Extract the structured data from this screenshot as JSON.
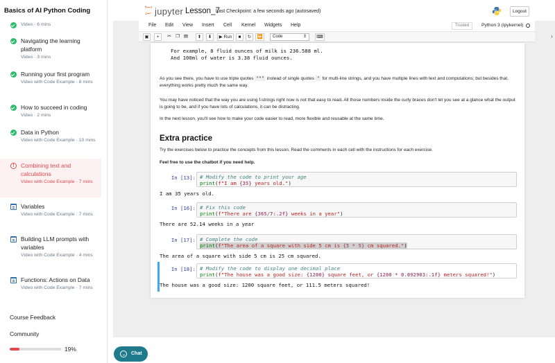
{
  "sidebar": {
    "course_title": "Basics of AI Python Coding",
    "lessons": [
      {
        "name": "",
        "meta": "Video · 6 mins",
        "status": "check"
      },
      {
        "name": "Navigating the learning platform",
        "meta": "Video · 3 mins",
        "status": "check"
      },
      {
        "name": "Running your first program",
        "meta": "Video with Code Example · 8 mins",
        "status": "check"
      },
      {
        "name": "How to succeed in coding",
        "meta": "Video · 2 mins",
        "status": "check"
      },
      {
        "name": "Data in Python",
        "meta": "Video with Code Example · 10 mins",
        "status": "check"
      },
      {
        "name": "Combining text and calculations",
        "meta": "Video with Code Example · 7 mins",
        "status": "warn"
      },
      {
        "name": "Variables",
        "meta": "Video with Code Example · 7 mins",
        "status": "code"
      },
      {
        "name": "Building LLM prompts with variables",
        "meta": "Video with Code Example · 4 mins",
        "status": "code"
      },
      {
        "name": "Functions: Actions on Data",
        "meta": "Video with Code Example · 7 mins",
        "status": "code"
      }
    ],
    "course_feedback": "Course Feedback",
    "community": "Community",
    "progress_percent": 19,
    "progress_label": "19%"
  },
  "jupyter": {
    "logo_text": "jupyter",
    "notebook_name": "Lesson_7",
    "checkpoint": "Last Checkpoint: a few seconds ago  (autosaved)",
    "logout": "Logout",
    "menu": [
      "File",
      "Edit",
      "View",
      "Insert",
      "Cell",
      "Kernel",
      "Widgets",
      "Help"
    ],
    "trusted": "Trusted",
    "kernel": "Python 3 (ipykernel)",
    "toolbar": {
      "icons": [
        "save-icon",
        "add-cell-icon",
        "cut-icon",
        "copy-icon",
        "paste-icon",
        "move-up-icon",
        "move-down-icon",
        "run-icon",
        "stop-icon",
        "restart-icon",
        "fast-forward-icon",
        "keyboard-icon"
      ],
      "run_label": "Run",
      "cell_type": "Code"
    }
  },
  "notebook": {
    "top_output": [
      "For example, 8 fluid ounces of milk is 236.588 ml.",
      "And 100ml of water is 3.38 fluid ounces."
    ],
    "para1_a": "As you see there, you have to use triple quotes ",
    "para1_code1": "\"\"\"",
    "para1_b": " instead of single quotes ",
    "para1_code2": "\"",
    "para1_c": " for multi-line strings, and you have multiple lines with text and computations; but besides that, everything works pretty much the same way.",
    "para2": "You may have noticed that the way you are using f-strings right now is not that easy to read. All those numbers inside the curly braces don't let you see at a glance what the output is going to be, and if you have lots of calculations, it can be distracting.",
    "para3": "In the next lesson, you'll see how to make your code easier to read, more flexible and reusable at the same time.",
    "extra_title": "Extra practice",
    "extra_desc": "Try the exercises below to practice the concepts from this lesson. Read the comments in each cell with the instructions for each exercise.",
    "extra_bold": "Feel free to use the chatbot if you need help.",
    "cells": [
      {
        "prompt": "In [13]:",
        "comment": "# Modify the code to print your age",
        "fn": "print",
        "p1": "(",
        "pre": "f\"I am ",
        "ex": "{35}",
        "post": " years old.\"",
        "p2": ")",
        "output": "I am 35 years old."
      },
      {
        "prompt": "In [16]:",
        "comment": "# Fix this code",
        "fn": "print",
        "p1": "(",
        "pre": "f\"There are ",
        "ex": "{365/7:.2f}",
        "post": " weeks in a year\"",
        "p2": ")",
        "output": "There are 52.14 weeks in a year"
      },
      {
        "prompt": "In [17]:",
        "comment": "# Complete the code",
        "fn": "print",
        "p1": "(",
        "pre": "f\"The area of a square with side 5 cm is ",
        "ex": "{5 * 5}",
        "post": " cm squared.\"",
        "p2": ")",
        "output": "The area of a square with side 5 cm is 25 cm squared."
      },
      {
        "prompt": "In [18]:",
        "comment": "# Modify the code to display one decimal place",
        "fn": "print",
        "p1": "(",
        "pre": "f\"The house was a good size: ",
        "ex": "{1200}",
        "mid": " square feet, or ",
        "ex2": "{1200 * 0.092903:.1f}",
        "post": " meters squared!\"",
        "p2": ")",
        "output": "The house was a good size: 1200 square feet, or 111.5 meters squared!"
      }
    ]
  },
  "chat": {
    "label": "Chat"
  },
  "colors": {
    "accent": "#e5484d",
    "success": "#2ebd6b",
    "chat": "#1f7a8c",
    "selected_cell": "#42a5f5"
  }
}
